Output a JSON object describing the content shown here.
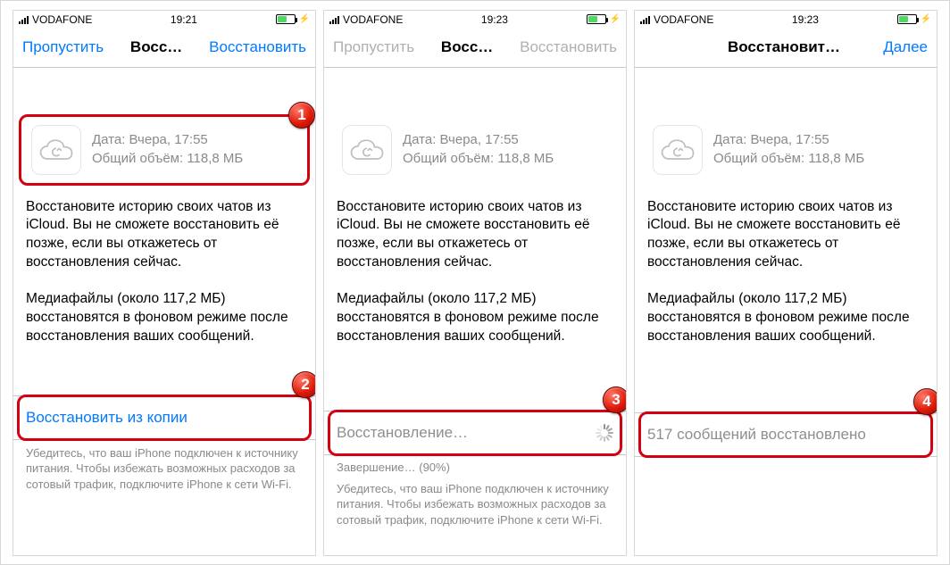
{
  "screens": [
    {
      "status": {
        "carrier": "VODAFONE",
        "time": "19:21",
        "battery_pct": 50
      },
      "nav": {
        "left": "Пропустить",
        "title": "Восс…",
        "right": "Восстановить",
        "left_dim": false,
        "right_dim": false
      },
      "backup": {
        "date_line": "Дата: Вчера, 17:55",
        "size_line": "Общий объём: 118,8 МБ"
      },
      "desc": "Восстановите историю своих чатов из iCloud. Вы не сможете восстановить её позже, если вы откажетесь от восстановления сейчас.",
      "desc2": "Медиафайлы (около 117,2 МБ) восстановятся в фоновом режиме после восстановления ваших сообщений.",
      "action": {
        "type": "link",
        "label": "Восстановить из копии"
      },
      "below_action": {
        "progress": null,
        "disclaimer": "Убедитесь, что ваш iPhone подключен к источнику питания. Чтобы избежать возможных расходов за сотовый трафик, подключите iPhone к сети Wi-Fi."
      }
    },
    {
      "status": {
        "carrier": "VODAFONE",
        "time": "19:23",
        "battery_pct": 50
      },
      "nav": {
        "left": "Пропустить",
        "title": "Восс…",
        "right": "Восстановить",
        "left_dim": true,
        "right_dim": true
      },
      "backup": {
        "date_line": "Дата: Вчера, 17:55",
        "size_line": "Общий объём: 118,8 МБ"
      },
      "desc": "Восстановите историю своих чатов из iCloud. Вы не сможете восстановить её позже, если вы откажетесь от восстановления сейчас.",
      "desc2": "Медиафайлы (около 117,2 МБ) восстановятся в фоновом режиме после восстановления ваших сообщений.",
      "action": {
        "type": "progress",
        "label": "Восстановление…"
      },
      "below_action": {
        "progress": "Завершение… (90%)",
        "disclaimer": "Убедитесь, что ваш iPhone подключен к источнику питания. Чтобы избежать возможных расходов за сотовый трафик, подключите iPhone к сети Wi-Fi."
      }
    },
    {
      "status": {
        "carrier": "VODAFONE",
        "time": "19:23",
        "battery_pct": 50
      },
      "nav": {
        "left": "",
        "title": "Восстановить из iCloud",
        "right": "Далее",
        "left_dim": false,
        "right_dim": false
      },
      "backup": {
        "date_line": "Дата: Вчера, 17:55",
        "size_line": "Общий объём: 118,8 МБ"
      },
      "desc": "Восстановите историю своих чатов из iCloud. Вы не сможете восстановить её позже, если вы откажетесь от восстановления сейчас.",
      "desc2": "Медиафайлы (около 117,2 МБ) восстановятся в фоновом режиме после восстановления ваших сообщений.",
      "action": {
        "type": "done",
        "label": "517 сообщений восстановлено"
      },
      "below_action": {
        "progress": null,
        "disclaimer": null
      }
    }
  ],
  "annotations": {
    "1": "1",
    "2": "2",
    "3": "3",
    "4": "4"
  }
}
